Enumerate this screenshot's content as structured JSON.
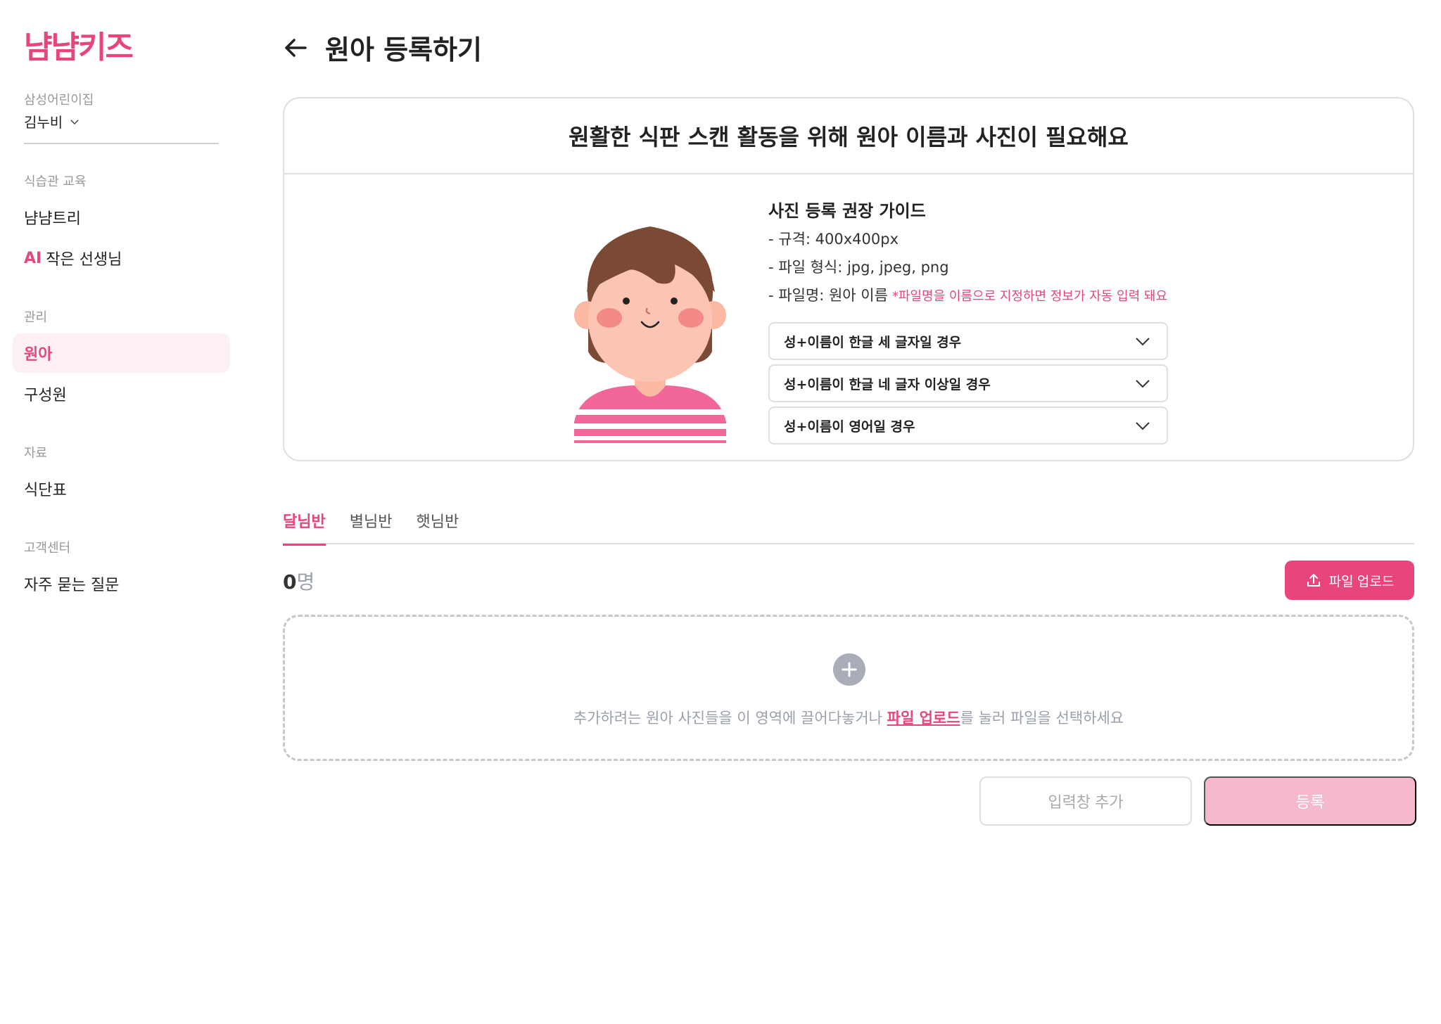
{
  "sidebar": {
    "logo": "냠냠키즈",
    "org": "삼성어린이집",
    "user": "김누비",
    "sections": {
      "edu": "식습관 교육",
      "manage": "관리",
      "material": "자료",
      "support": "고객센터"
    },
    "items": {
      "tree": "냠냠트리",
      "ai_tag": "AI",
      "ai_teacher": "작은 선생님",
      "child": "원아",
      "member": "구성원",
      "menu": "식단표",
      "faq": "자주 묻는 질문"
    }
  },
  "header": {
    "title": "원아 등록하기"
  },
  "guide": {
    "heading": "원활한 식판 스캔 활동을 위해 원아 이름과 사진이 필요해요",
    "title": "사진 등록 권장 가이드",
    "spec": "- 규격: 400x400px",
    "format": "- 파일 형식: jpg, jpeg, png",
    "filename": "- 파일명: 원아 이름",
    "filename_note": "*파일명을 이름으로 지정하면 정보가 자동 입력 돼요",
    "accordions": [
      "성+이름이 한글 세 글자일 경우",
      "성+이름이 한글 네 글자 이상일 경우",
      "성+이름이 영어일 경우"
    ]
  },
  "tabs": [
    "달님반",
    "별님반",
    "햇님반"
  ],
  "count": {
    "value": "0",
    "unit": "명"
  },
  "upload_button": "파일 업로드",
  "dropzone": {
    "before": "추가하려는 원아 사진들을 이 영역에 끌어다놓거나 ",
    "link": "파일 업로드",
    "after": "를 눌러 파일을 선택하세요"
  },
  "actions": {
    "add_input": "입력창 추가",
    "register": "등록"
  },
  "colors": {
    "accent": "#e8457e",
    "accent_light": "#f5b8cd",
    "active_bg": "#fdf0f4"
  }
}
